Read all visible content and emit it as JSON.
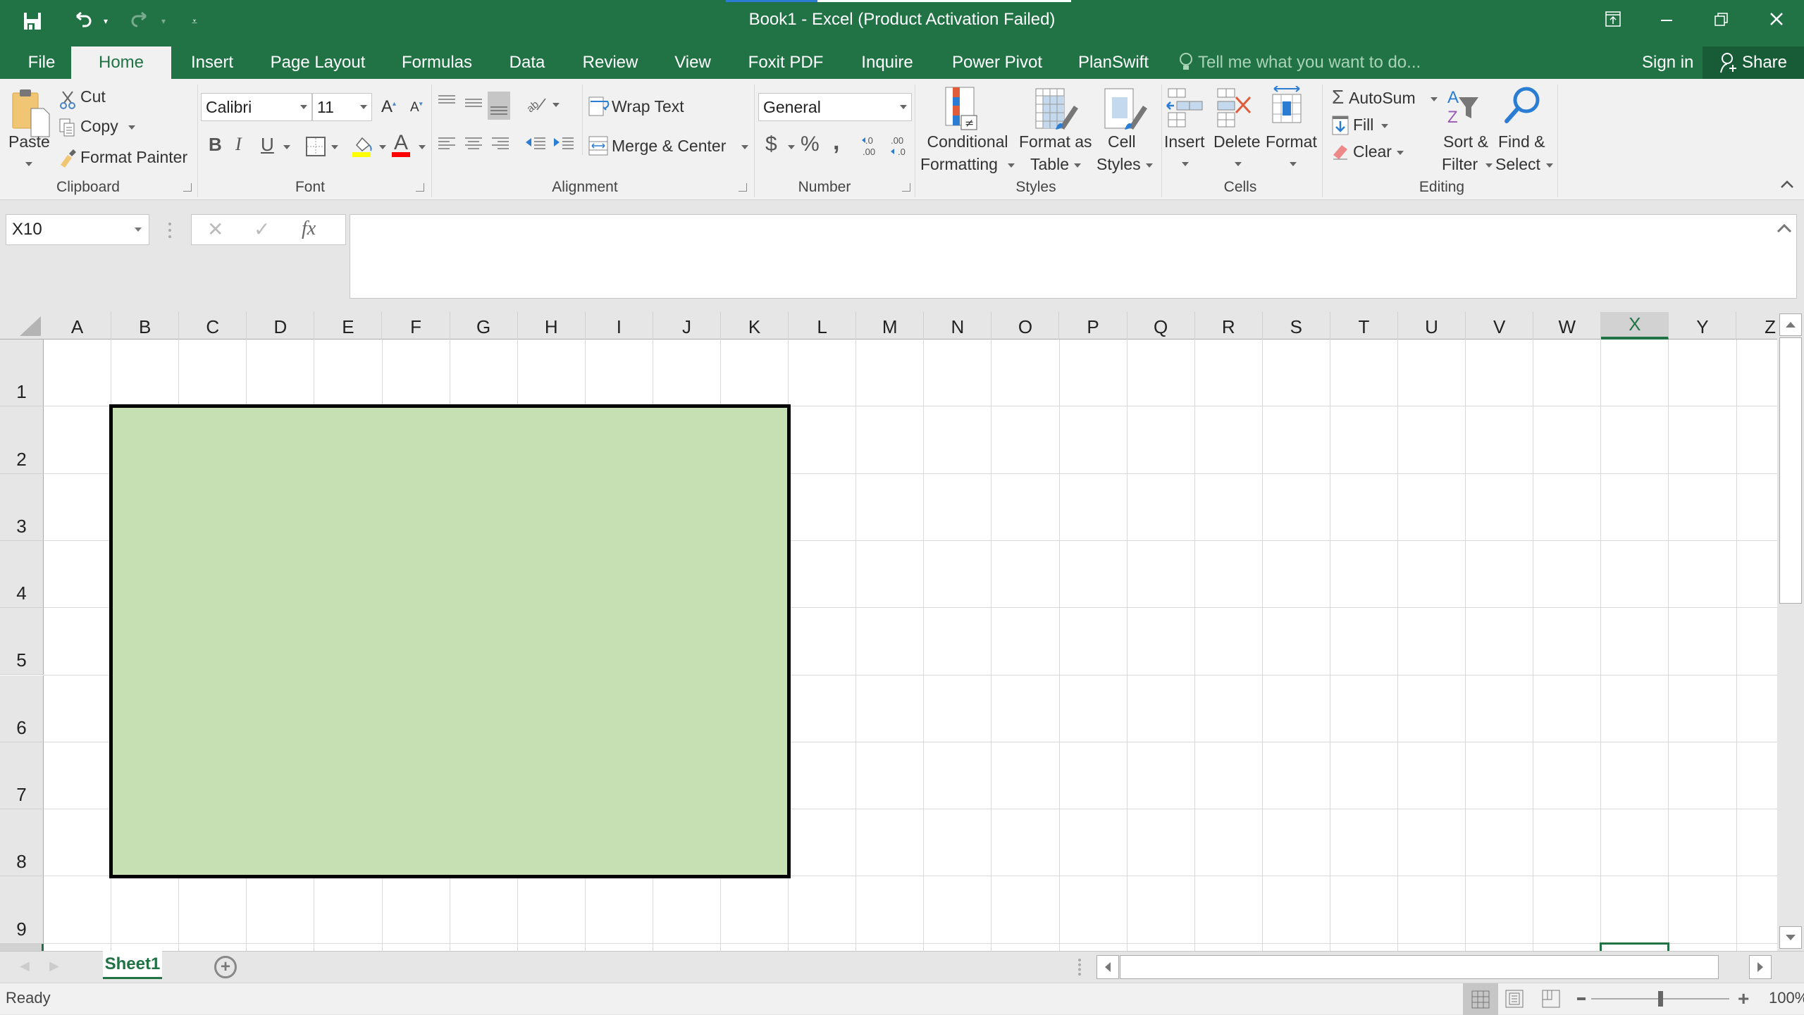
{
  "window": {
    "title": "Book1 - Excel (Product Activation Failed)",
    "controls": [
      "ribbon-display-options",
      "minimize",
      "restore",
      "close"
    ]
  },
  "quick_access": {
    "save_icon": "save-icon",
    "undo_icon": "undo-icon",
    "redo_icon": "redo-icon",
    "customize_icon": "customize-qat-icon"
  },
  "tabs": [
    {
      "label": "File"
    },
    {
      "label": "Home",
      "active": true
    },
    {
      "label": "Insert"
    },
    {
      "label": "Page Layout"
    },
    {
      "label": "Formulas"
    },
    {
      "label": "Data"
    },
    {
      "label": "Review"
    },
    {
      "label": "View"
    },
    {
      "label": "Foxit PDF"
    },
    {
      "label": "Inquire"
    },
    {
      "label": "Power Pivot"
    },
    {
      "label": "PlanSwift"
    }
  ],
  "tell_me": {
    "placeholder": "Tell me what you want to do..."
  },
  "account": {
    "sign_in": "Sign in",
    "share": "Share"
  },
  "ribbon": {
    "clipboard": {
      "label": "Clipboard",
      "paste": "Paste",
      "cut": "Cut",
      "copy": "Copy",
      "format_painter": "Format Painter"
    },
    "font": {
      "label": "Font",
      "font_name": "Calibri",
      "font_size": "11",
      "bold": "B",
      "italic": "I",
      "underline": "U",
      "highlight_color": "#ffff00",
      "font_color": "#ff0000"
    },
    "alignment": {
      "label": "Alignment",
      "wrap_text": "Wrap Text",
      "merge_center": "Merge & Center"
    },
    "number": {
      "label": "Number",
      "format": "General",
      "currency": "$",
      "percent": "%",
      "comma": ","
    },
    "styles": {
      "label": "Styles",
      "conditional_formatting": [
        "Conditional",
        "Formatting"
      ],
      "format_as_table": [
        "Format as",
        "Table"
      ],
      "cell_styles": [
        "Cell",
        "Styles"
      ]
    },
    "cells": {
      "label": "Cells",
      "insert": "Insert",
      "delete": "Delete",
      "format": "Format"
    },
    "editing": {
      "label": "Editing",
      "autosum": "AutoSum",
      "fill": "Fill",
      "clear": "Clear",
      "sort_filter": [
        "Sort &",
        "Filter"
      ],
      "find_select": [
        "Find &",
        "Select"
      ]
    }
  },
  "formula_bar": {
    "name_box": "X10",
    "cancel": "✕",
    "enter": "✓",
    "fx": "fx",
    "formula": ""
  },
  "sheet": {
    "columns": [
      "A",
      "B",
      "C",
      "D",
      "E",
      "F",
      "G",
      "H",
      "I",
      "J",
      "K",
      "L",
      "M",
      "N",
      "O",
      "P",
      "Q",
      "R",
      "S",
      "T",
      "U",
      "V",
      "W",
      "X",
      "Y",
      "Z"
    ],
    "rows": [
      "1",
      "2",
      "3",
      "4",
      "5",
      "6",
      "7",
      "8",
      "9"
    ],
    "selected_column": "X",
    "active_cell": "X10",
    "filled_range": {
      "range": "B2:K8",
      "fill_color": "#c6e0b4",
      "border": "thick black outline"
    }
  },
  "sheet_tabs": {
    "tabs": [
      {
        "label": "Sheet1",
        "active": true
      }
    ],
    "add_sheet": "+"
  },
  "status": {
    "text": "Ready",
    "zoom": "100%",
    "zoom_level_percent": 100
  }
}
